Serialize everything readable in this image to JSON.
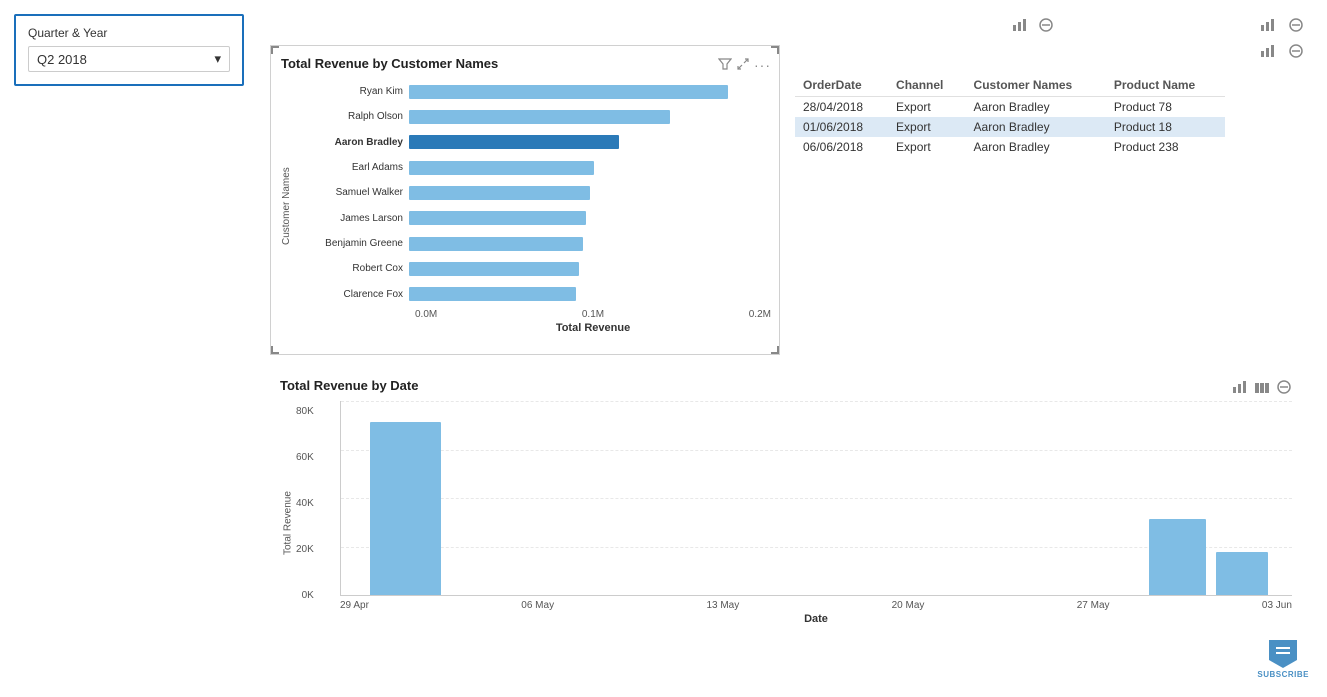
{
  "filter": {
    "label": "Quarter & Year",
    "value": "Q2 2018"
  },
  "bar_chart": {
    "title": "Total Revenue by Customer Names",
    "y_axis_label": "Customer Names",
    "x_axis_label": "Total Revenue",
    "x_ticks": [
      "0.0M",
      "0.1M",
      "0.2M"
    ],
    "rows": [
      {
        "label": "Ryan Kim",
        "bold": false,
        "pct": 88
      },
      {
        "label": "Ralph Olson",
        "bold": false,
        "pct": 72
      },
      {
        "label": "Aaron Bradley",
        "bold": true,
        "pct": 58,
        "highlighted": true
      },
      {
        "label": "Earl Adams",
        "bold": false,
        "pct": 51
      },
      {
        "label": "Samuel Walker",
        "bold": false,
        "pct": 50
      },
      {
        "label": "James Larson",
        "bold": false,
        "pct": 49
      },
      {
        "label": "Benjamin Greene",
        "bold": false,
        "pct": 48
      },
      {
        "label": "Robert Cox",
        "bold": false,
        "pct": 47
      },
      {
        "label": "Clarence Fox",
        "bold": false,
        "pct": 46
      }
    ]
  },
  "table": {
    "headers": [
      "OrderDate",
      "Channel",
      "Customer Names",
      "Product Name"
    ],
    "rows": [
      {
        "date": "28/04/2018",
        "channel": "Export",
        "customer": "Aaron Bradley",
        "product": "Product 78"
      },
      {
        "date": "01/06/2018",
        "channel": "Export",
        "customer": "Aaron Bradley",
        "product": "Product 18"
      },
      {
        "date": "06/06/2018",
        "channel": "Export",
        "customer": "Aaron Bradley",
        "product": "Product 238"
      }
    ]
  },
  "date_chart": {
    "title": "Total Revenue by Date",
    "y_axis_label": "Total Revenue",
    "x_axis_label": "Date",
    "y_ticks": [
      "80K",
      "60K",
      "40K",
      "20K",
      "0K"
    ],
    "x_labels": [
      "29 Apr",
      "06 May",
      "13 May",
      "20 May",
      "27 May",
      "03 Jun"
    ],
    "bars": [
      {
        "x_pct": 3,
        "width_pct": 8,
        "height_pct": 89,
        "label": "29 Apr"
      },
      {
        "x_pct": 85,
        "width_pct": 7,
        "height_pct": 39,
        "label": "03 Jun"
      },
      {
        "x_pct": 93,
        "width_pct": 6,
        "height_pct": 22,
        "label": ""
      }
    ]
  },
  "icons": {
    "chart_bar": "📊",
    "no_entry": "⊘",
    "filter": "▽",
    "expand": "⤢",
    "more": "...",
    "subscribe_text": "SUBSCRIBE"
  },
  "colors": {
    "bar_blue": "#7fbde4",
    "bar_highlight": "#2b7ab8",
    "accent": "#1a6fbb"
  }
}
